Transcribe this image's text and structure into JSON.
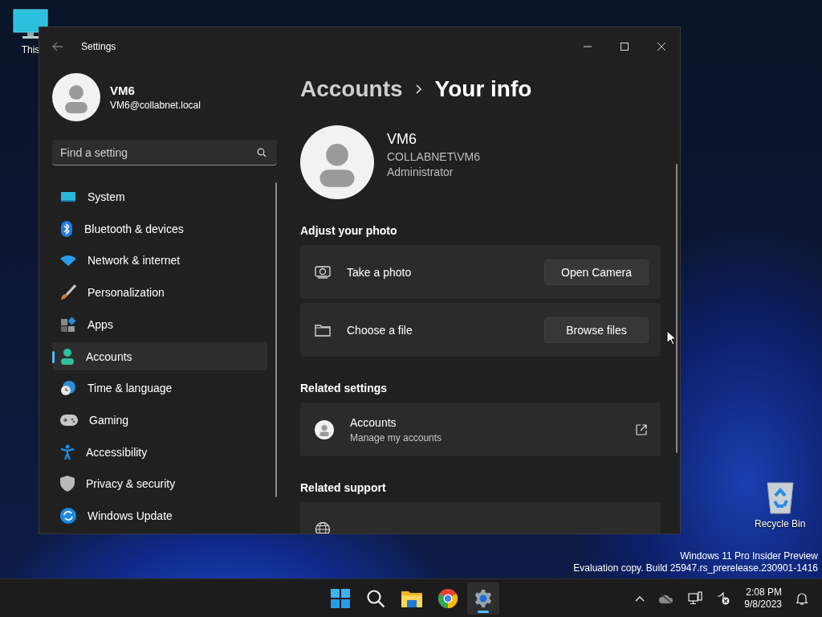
{
  "desktop": {
    "icons": [
      {
        "label": "This"
      },
      {
        "label": "Recycle Bin"
      }
    ],
    "edition": [
      "Windows 11 Pro Insider Preview",
      "Evaluation copy. Build 25947.rs_prerelease.230901-1416"
    ]
  },
  "window": {
    "title": "Settings"
  },
  "user": {
    "name": "VM6",
    "email": "VM6@collabnet.local"
  },
  "search": {
    "placeholder": "Find a setting"
  },
  "sidebar": {
    "items": [
      {
        "label": "System",
        "selected": false
      },
      {
        "label": "Bluetooth & devices",
        "selected": false
      },
      {
        "label": "Network & internet",
        "selected": false
      },
      {
        "label": "Personalization",
        "selected": false
      },
      {
        "label": "Apps",
        "selected": false
      },
      {
        "label": "Accounts",
        "selected": true
      },
      {
        "label": "Time & language",
        "selected": false
      },
      {
        "label": "Gaming",
        "selected": false
      },
      {
        "label": "Accessibility",
        "selected": false
      },
      {
        "label": "Privacy & security",
        "selected": false
      },
      {
        "label": "Windows Update",
        "selected": false
      }
    ]
  },
  "breadcrumb": [
    "Accounts",
    "Your info"
  ],
  "profile": {
    "name": "VM6",
    "account": "COLLABNET\\VM6",
    "role": "Administrator"
  },
  "sections": [
    {
      "heading": "Adjust your photo",
      "cards": [
        {
          "kind": "action",
          "label": "Take a photo",
          "button": "Open Camera"
        },
        {
          "kind": "action",
          "label": "Choose a file",
          "button": "Browse files"
        }
      ]
    },
    {
      "heading": "Related settings",
      "cards": [
        {
          "kind": "link",
          "label": "Accounts",
          "description": "Manage my accounts"
        }
      ]
    },
    {
      "heading": "Related support",
      "cards": [
        {
          "kind": "partial"
        }
      ]
    }
  ],
  "clock": {
    "time": "2:08 PM",
    "date": "9/8/2023"
  }
}
